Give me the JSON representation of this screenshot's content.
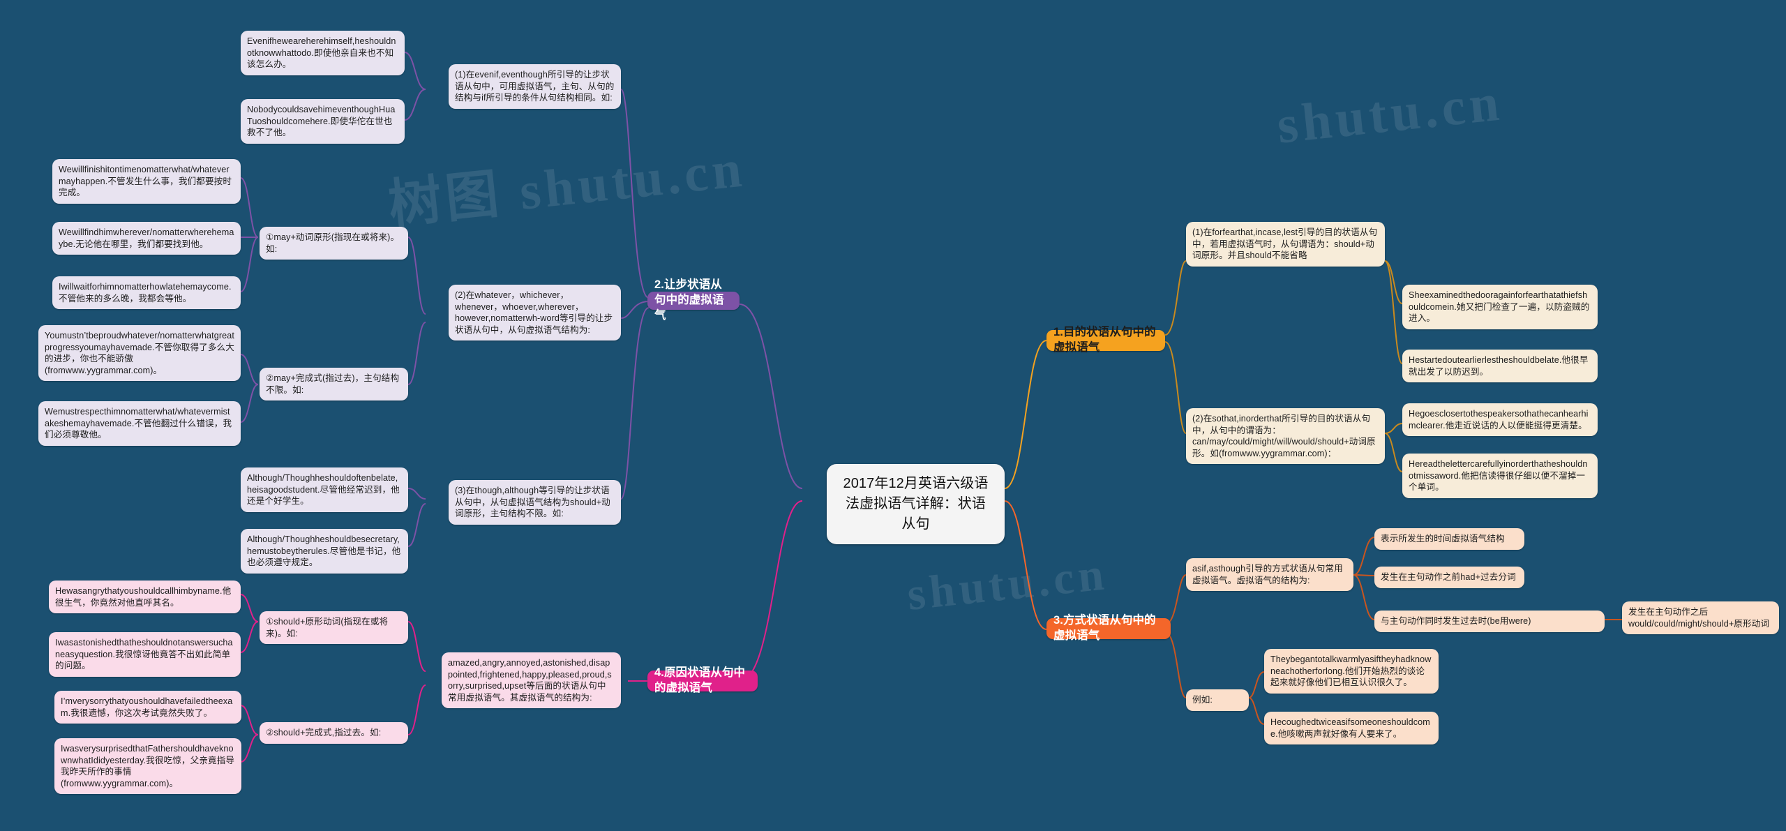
{
  "root": {
    "title": "2017年12月英语六级语法虚拟语气详解：状语从句"
  },
  "watermark": {
    "text1": "树图 shutu.cn",
    "text2": "shutu.cn",
    "text3": "shutu.cn"
  },
  "colors": {
    "background": "#1b5071",
    "branch2_purple": "#7d52a6",
    "branch4_pink": "#e0218a",
    "branch1_orange": "#f5a21f",
    "branch3_orange_dark": "#f4662a",
    "leaf_lilac": "#e8e3f0",
    "leaf_pink": "#fadbe9",
    "leaf_cream": "#f7ecd9",
    "leaf_peach": "#fbdfcb",
    "root_bg": "#f4f4f4"
  },
  "branches": {
    "b2": {
      "label": "2.让步状语从句中的虚拟语气",
      "c1": {
        "label": "(1)在evenif,eventhough所引导的让步状语从句中，可用虚拟语气，主句、从句的结构与if所引导的条件从句结构相同。如:",
        "leaves": [
          "Evenifheweareherehimself,heshouldnotknowwhattodo.即使他亲自来也不知该怎么办。",
          "NobodycouldsavehimeventhoughHuaTuoshouldcomehere.即使华佗在世也救不了他。"
        ]
      },
      "c2": {
        "label": "(2)在whatever，whichever，whenever，whoever,wherever，however,nomatterwh-word等引导的让步状语从句中，从句虚拟语气结构为:",
        "sub1": {
          "label": "①may+动词原形(指现在或将来)。如:",
          "leaves": [
            "Wewillfinishitontimenomatterwhat/whatevermayhappen.不管发生什么事，我们都要按时完成。",
            "Wewillfindhimwherever/nomatterwherehemaybe.无论他在哪里，我们都要找到他。",
            "Iwillwaitforhimnomatterhowlatehemaycome.不管他来的多么晚，我都会等他。"
          ]
        },
        "sub2": {
          "label": "②may+完成式(指过去)，主句结构不限。如:",
          "leaves": [
            "Youmustn’tbeproudwhatever/nomatterwhatgreatprogressyoumayhavemade.不管你取得了多么大的进步，你也不能骄傲(fromwww.yygrammar.com)。",
            "Wemustrespecthimnomatterwhat/whatevermistakeshemayhavemade.不管他翻过什么错误，我们必须尊敬他。"
          ]
        }
      },
      "c3": {
        "label": "(3)在though,although等引导的让步状语从句中，从句虚拟语气结构为should+动词原形，主句结构不限。如:",
        "leaves": [
          "Although/Thoughheshouldoftenbelate,heisagoodstudent.尽管他经常迟到，他还是个好学生。",
          "Although/Thoughheshouldbesecretary,hemustobeytherules.尽管他是书记，他也必须遵守规定。"
        ]
      }
    },
    "b4": {
      "label": "4.原因状语从句中的虚拟语气",
      "c1": {
        "label": "amazed,angry,annoyed,astonished,disappointed,frightened,happy,pleased,proud,sorry,surprised,upset等后面的状语从句中常用虚拟语气。其虚拟语气的结构为:",
        "sub1": {
          "label": "①should+原形动词(指现在或将来)。如:",
          "leaves": [
            "Hewasangrythatyoushouldcallhimbyname.他很生气，你竟然对他直呼其名。",
            "Iwasastonishedthatheshouldnotanswersuchaneasyquestion.我很惊讶他竟答不出如此简单的问题。"
          ]
        },
        "sub2": {
          "label": "②should+完成式,指过去。如:",
          "leaves": [
            "I’mverysorrythatyoushouldhavefailedtheexam.我很遗憾，你这次考试竟然失败了。",
            "IwasverysurprisedthatFathershouldhaveknownwhatIdidyesterday.我很吃惊，父亲竟指导我昨天所作的事情(fromwww.yygrammar.com)。"
          ]
        }
      }
    },
    "b1": {
      "label": "1.目的状语从句中的虚拟语气",
      "c1": {
        "label": "(1)在forfearthat,incase,lest引导的目的状语从句中，若用虚拟语气时，从句谓语为：should+动词原形。并且should不能省略",
        "leaves": [
          "Sheexaminedthedooragainforfearthatathiefshouldcomein.她又把门检查了一遍，以防盗贼的进入。",
          "Hestartedoutearlierlestheshouldbelate.他很早就出发了以防迟到。"
        ]
      },
      "c2": {
        "label": "(2)在sothat,inorderthat所引导的目的状语从句中，从句中的谓语为：can/may/could/might/will/would/should+动词原形。如(fromwww.yygrammar.com)：",
        "leaves": [
          "Hegoesclosertothespeakersothathecanhearhimclearer.他走近说话的人以便能挺得更清楚。",
          "Hereadthelettercarefullyinorderthatheshouldnotmissaword.他把信读得很仔细以便不溜掉一个单词。"
        ]
      }
    },
    "b3": {
      "label": "3.方式状语从句中的虚拟语气",
      "c1": {
        "label": "asif,asthough引导的方式状语从句常用虚拟语气。虚拟语气的结构为:",
        "leaves": [
          "表示所发生的时间虚拟语气结构",
          "发生在主句动作之前had+过去分词",
          "与主句动作同时发生过去时(be用were)"
        ],
        "deep_leaf": "发生在主句动作之后would/could/might/should+原形动词"
      },
      "c2": {
        "label": "例如:",
        "leaves": [
          "Theybegantotalkwarmlyasiftheyhadknowneachotherforlong.他们开始热烈的谈论起来就好像他们已相互认识很久了。",
          "Hecoughedtwiceasifsomeoneshouldcome.他咳嗽两声就好像有人要来了。"
        ]
      }
    }
  }
}
